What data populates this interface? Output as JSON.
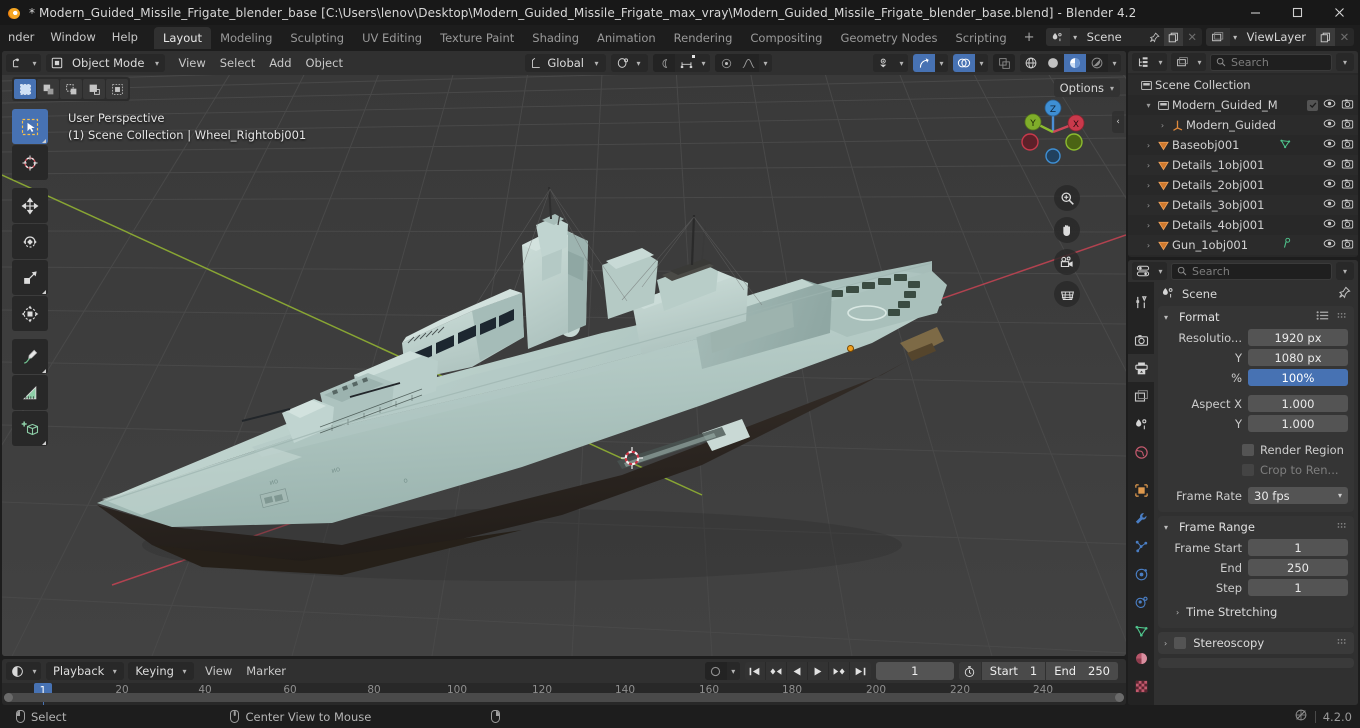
{
  "window": {
    "title": "* Modern_Guided_Missile_Frigate_blender_base [C:\\Users\\lenov\\Desktop\\Modern_Guided_Missile_Frigate_max_vray\\Modern_Guided_Missile_Frigate_blender_base.blend] - Blender 4.2",
    "minimize": "minimize-icon",
    "maximize": "maximize-icon",
    "close": "close-icon"
  },
  "topbar": {
    "menus": [
      "nder",
      "Window",
      "Help"
    ],
    "workspaces": [
      {
        "label": "Layout",
        "active": true
      },
      {
        "label": "Modeling",
        "active": false
      },
      {
        "label": "Sculpting",
        "active": false
      },
      {
        "label": "UV Editing",
        "active": false
      },
      {
        "label": "Texture Paint",
        "active": false
      },
      {
        "label": "Shading",
        "active": false
      },
      {
        "label": "Animation",
        "active": false
      },
      {
        "label": "Rendering",
        "active": false
      },
      {
        "label": "Compositing",
        "active": false
      },
      {
        "label": "Geometry Nodes",
        "active": false
      },
      {
        "label": "Scripting",
        "active": false
      }
    ],
    "add_workspace": "+",
    "scene_name": "Scene",
    "viewlayer_name": "ViewLayer"
  },
  "viewport": {
    "mode": "Object Mode",
    "menus": [
      "View",
      "Select",
      "Add",
      "Object"
    ],
    "transform_orientation": "Global",
    "options_label": "Options",
    "overlay_line1": "User Perspective",
    "overlay_line2": "(1) Scene Collection | Wheel_Rightobj001",
    "gizmo_axes": [
      "X",
      "Y",
      "Z"
    ],
    "colors": {
      "background": "#3c3c3c",
      "grid_line": "#4c4c4c",
      "axis_x": "#cc4a5c",
      "axis_y": "#9bbd3a",
      "hull": "#b9d0cb",
      "hull_shadow": "#8fa9a4",
      "hull_bottom": "#2a2420",
      "accent_blue": "#4772b3",
      "origin_orange": "#f0a020"
    },
    "tools": [
      "tweak-select-tool",
      "cursor-tool",
      "move-tool",
      "rotate-tool",
      "scale-tool",
      "transform-tool",
      "annotate-tool",
      "measure-tool",
      "add-cube-tool"
    ],
    "select_modes": [
      "select-box",
      "select-extend",
      "select-subtract",
      "select-invert",
      "select-intersect"
    ]
  },
  "outliner": {
    "search_placeholder": "Search",
    "rows": [
      {
        "name": "Scene Collection",
        "icon": "collection-icon",
        "indent": 0,
        "disclosure": "",
        "checkbox": false,
        "data_icon": "",
        "eye": false,
        "camera": false
      },
      {
        "name": "Modern_Guided_M",
        "icon": "collection-icon",
        "indent": 1,
        "disclosure": "down",
        "checkbox": true,
        "data_icon": "",
        "eye": true,
        "camera": true
      },
      {
        "name": "Modern_Guided",
        "icon": "empty-axes-icon",
        "indent": 2,
        "disclosure": "right",
        "checkbox": false,
        "data_icon": "",
        "eye": true,
        "camera": true
      },
      {
        "name": "Baseobj001",
        "icon": "mesh-object-icon",
        "indent": 1,
        "disclosure": "right",
        "checkbox": false,
        "data_icon": "mesh-data-icon",
        "eye": true,
        "camera": true
      },
      {
        "name": "Details_1obj001",
        "icon": "mesh-object-icon",
        "indent": 1,
        "disclosure": "right",
        "checkbox": false,
        "data_icon": "",
        "eye": true,
        "camera": true
      },
      {
        "name": "Details_2obj001",
        "icon": "mesh-object-icon",
        "indent": 1,
        "disclosure": "right",
        "checkbox": false,
        "data_icon": "",
        "eye": true,
        "camera": true
      },
      {
        "name": "Details_3obj001",
        "icon": "mesh-object-icon",
        "indent": 1,
        "disclosure": "right",
        "checkbox": false,
        "data_icon": "",
        "eye": true,
        "camera": true
      },
      {
        "name": "Details_4obj001",
        "icon": "mesh-object-icon",
        "indent": 1,
        "disclosure": "right",
        "checkbox": false,
        "data_icon": "",
        "eye": true,
        "camera": true
      },
      {
        "name": "Gun_1obj001",
        "icon": "mesh-object-icon",
        "indent": 1,
        "disclosure": "right",
        "checkbox": false,
        "data_icon": "vertex-group-icon",
        "eye": true,
        "camera": true
      }
    ]
  },
  "properties": {
    "search_placeholder": "Search",
    "breadcrumb": "Scene",
    "tabs": [
      "tool-icon",
      "render-icon",
      "output-icon",
      "view-layer-icon",
      "scene-icon",
      "world-icon",
      "object-icon",
      "modifier-icon",
      "particles-icon",
      "physics-icon",
      "constraint-icon",
      "data-icon",
      "material-icon",
      "texture-icon"
    ],
    "active_tab_index": 2,
    "format_panel": {
      "title": "Format",
      "rows": [
        {
          "label": "Resolutio...",
          "value": "1920 px",
          "highlight": false
        },
        {
          "label": "Y",
          "value": "1080 px",
          "highlight": false
        },
        {
          "label": "%",
          "value": "100%",
          "highlight": true
        },
        {
          "label": "Aspect X",
          "value": "1.000",
          "highlight": false
        },
        {
          "label": "Y",
          "value": "1.000",
          "highlight": false
        }
      ],
      "checkboxes": [
        {
          "label": "Render Region",
          "checked": false,
          "disabled": false
        },
        {
          "label": "Crop to Ren...",
          "checked": false,
          "disabled": true
        }
      ],
      "frame_rate_label": "Frame Rate",
      "frame_rate_value": "30 fps"
    },
    "frame_range_panel": {
      "title": "Frame Range",
      "rows": [
        {
          "label": "Frame Start",
          "value": "1"
        },
        {
          "label": "End",
          "value": "250"
        },
        {
          "label": "Step",
          "value": "1"
        }
      ],
      "subpanel": "Time Stretching"
    },
    "stereoscopy_panel": {
      "title": "Stereoscopy",
      "checked": false
    }
  },
  "timeline": {
    "menus": [
      "View",
      "Marker"
    ],
    "playback_label": "Playback",
    "keying_label": "Keying",
    "current_frame": "1",
    "start_label": "Start",
    "start_value": "1",
    "end_label": "End",
    "end_value": "250",
    "playhead_frame": "1",
    "ticks": [
      "20",
      "40",
      "60",
      "80",
      "100",
      "120",
      "140",
      "160",
      "180",
      "200",
      "220",
      "240"
    ],
    "transport": [
      "jump-to-start-icon",
      "prev-keyframe-icon",
      "play-reverse-icon",
      "play-icon",
      "next-keyframe-icon",
      "jump-to-end-icon"
    ]
  },
  "statusbar": {
    "items": [
      {
        "mouse": "left",
        "label": "Select"
      },
      {
        "mouse": "middle",
        "label": "Center View to Mouse"
      },
      {
        "mouse": "right",
        "label": ""
      }
    ],
    "version": "4.2.0"
  }
}
